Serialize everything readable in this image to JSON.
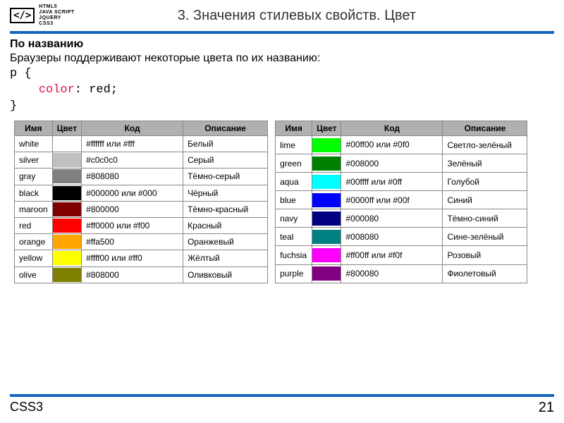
{
  "header": {
    "logo_icon": "</>",
    "logo_stack": [
      "HTML5",
      "JAVA SCRIPT",
      "JQUERY",
      "CSS3"
    ],
    "title": "3. Значения стилевых свойств. Цвет"
  },
  "body": {
    "subtitle": "По названию",
    "intro": "Браузеры поддерживают некоторые цвета по их названию:",
    "code": {
      "line1": "p {",
      "line2_indent": "    ",
      "line2_kw": "color",
      "line2_rest": ": red;",
      "line3": "}"
    },
    "table_headers": {
      "name": "Имя",
      "color": "Цвет",
      "code": "Код",
      "desc": "Описание"
    },
    "left": [
      {
        "name": "white",
        "hex": "#ffffff",
        "code": "#ffffff или #fff",
        "desc": "Белый"
      },
      {
        "name": "silver",
        "hex": "#c0c0c0",
        "code": "#c0c0c0",
        "desc": "Серый"
      },
      {
        "name": "gray",
        "hex": "#808080",
        "code": "#808080",
        "desc": "Тёмно-серый"
      },
      {
        "name": "black",
        "hex": "#000000",
        "code": "#000000 или #000",
        "desc": "Чёрный"
      },
      {
        "name": "maroon",
        "hex": "#800000",
        "code": "#800000",
        "desc": "Тёмно-красный"
      },
      {
        "name": "red",
        "hex": "#ff0000",
        "code": "#ff0000 или #f00",
        "desc": "Красный"
      },
      {
        "name": "orange",
        "hex": "#ffa500",
        "code": "#ffa500",
        "desc": "Оранжевый"
      },
      {
        "name": "yellow",
        "hex": "#ffff00",
        "code": "#ffff00 или #ff0",
        "desc": "Жёлтый"
      },
      {
        "name": "olive",
        "hex": "#808000",
        "code": "#808000",
        "desc": "Оливковый"
      }
    ],
    "right": [
      {
        "name": "lime",
        "hex": "#00ff00",
        "code": "#00ff00 или #0f0",
        "desc": "Светло-зелёный"
      },
      {
        "name": "green",
        "hex": "#008000",
        "code": "#008000",
        "desc": "Зелёный"
      },
      {
        "name": "aqua",
        "hex": "#00ffff",
        "code": "#00ffff или #0ff",
        "desc": "Голубой"
      },
      {
        "name": "blue",
        "hex": "#0000ff",
        "code": "#0000ff или #00f",
        "desc": "Синий"
      },
      {
        "name": "navy",
        "hex": "#000080",
        "code": "#000080",
        "desc": "Тёмно-синий"
      },
      {
        "name": "teal",
        "hex": "#008080",
        "code": "#008080",
        "desc": "Сине-зелёный"
      },
      {
        "name": "fuchsia",
        "hex": "#ff00ff",
        "code": "#ff00ff или #f0f",
        "desc": "Розовый"
      },
      {
        "name": "purple",
        "hex": "#800080",
        "code": "#800080",
        "desc": "Фиолетовый"
      }
    ]
  },
  "footer": {
    "label": "CSS3",
    "page": "21"
  }
}
